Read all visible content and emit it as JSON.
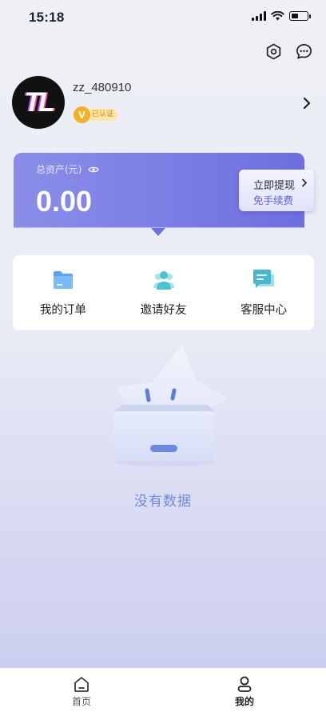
{
  "status_bar": {
    "time": "15:18",
    "battery_level": 0.45
  },
  "header": {
    "icons": [
      "settings-icon",
      "chat-icon"
    ]
  },
  "profile": {
    "avatar_text": "TL",
    "username": "zz_480910",
    "badge_letter": "V",
    "badge_label": "已认证"
  },
  "assets": {
    "label": "总资产(元)",
    "amount": "0.00",
    "withdraw_title": "立即提现",
    "withdraw_sub": "免手续费"
  },
  "menu": {
    "items": [
      {
        "label": "我的订单",
        "icon": "order-folder-icon"
      },
      {
        "label": "邀请好友",
        "icon": "invite-friends-icon"
      },
      {
        "label": "客服中心",
        "icon": "customer-service-icon"
      }
    ]
  },
  "empty": {
    "text": "没有数据"
  },
  "tabbar": {
    "tabs": [
      {
        "label": "首页",
        "icon": "home-icon"
      },
      {
        "label": "我的",
        "icon": "profile-icon"
      }
    ]
  },
  "colors": {
    "accent": "#6e6fe0",
    "empty_text": "#6e8be0",
    "badge": "#f1b02e"
  }
}
